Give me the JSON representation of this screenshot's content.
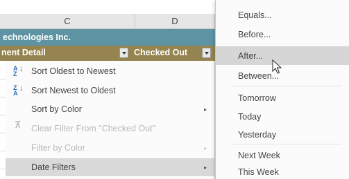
{
  "sheet": {
    "col_c": "C",
    "col_d": "D",
    "title_text": "echnologies Inc.",
    "detail_label": "nent Detail",
    "checked_out_label": "Checked Out"
  },
  "menu": {
    "items": [
      {
        "label": "Sort Oldest to Newest",
        "icon": "sort-ascending-icon"
      },
      {
        "label": "Sort Newest to Oldest",
        "icon": "sort-descending-icon"
      },
      {
        "label": "Sort by Color",
        "has_submenu": true
      },
      {
        "label": "Clear Filter From \"Checked Out\"",
        "disabled": true,
        "icon": "clear-filter-icon"
      },
      {
        "label": "Filter by Color",
        "disabled": true,
        "has_submenu": true
      },
      {
        "label": "Date Filters",
        "active": true,
        "has_submenu": true
      }
    ],
    "submenu_arrow": "▸"
  },
  "date_filters": {
    "items": [
      "Equals...",
      "Before...",
      "After...",
      "Between...",
      "Tomorrow",
      "Today",
      "Yesterday",
      "Next Week",
      "This Week"
    ],
    "hovered": "After..."
  }
}
